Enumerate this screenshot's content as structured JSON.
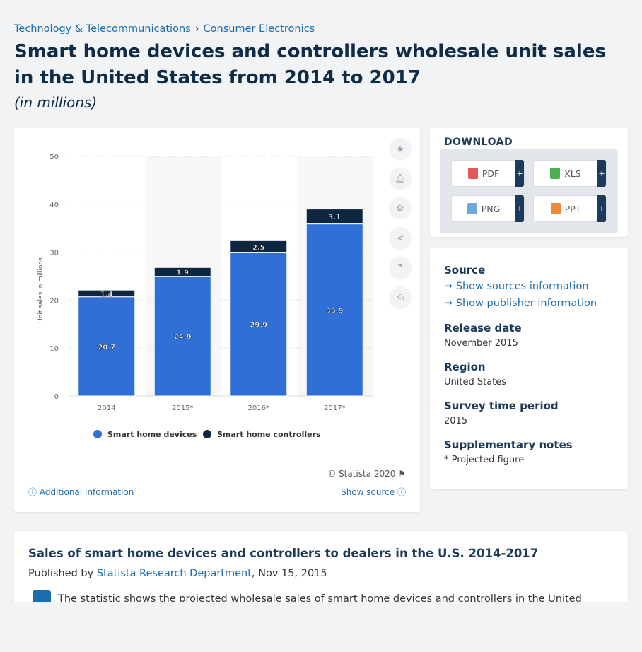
{
  "breadcrumb": {
    "first": "Technology & Telecommunications",
    "second": "Consumer Electronics"
  },
  "title": "Smart home devices and controllers wholesale unit sales in the United States from 2014 to 2017",
  "subtitle": "(in millions)",
  "tools": [
    "star-icon",
    "bell-icon",
    "gear-icon",
    "share-icon",
    "quote-icon",
    "print-icon"
  ],
  "download": {
    "title": "DOWNLOAD",
    "buttons": [
      {
        "label": "PDF",
        "plus": "+",
        "color": "#e05a5a"
      },
      {
        "label": "XLS",
        "plus": "+",
        "color": "#4caf50"
      },
      {
        "label": "PNG",
        "plus": "+",
        "color": "#6fa8dc"
      },
      {
        "label": "PPT",
        "plus": "+",
        "color": "#ef8a3c"
      }
    ]
  },
  "info": {
    "source_label": "Source",
    "show_sources": "Show sources information",
    "show_publisher": "Show publisher information",
    "release_label": "Release date",
    "release_value": "November 2015",
    "region_label": "Region",
    "region_value": "United States",
    "survey_label": "Survey time period",
    "survey_value": "2015",
    "notes_label": "Supplementary notes",
    "notes_value": "* Projected figure"
  },
  "chart_footer": {
    "copyright": "© Statista 2020",
    "additional": "Additional Information",
    "show_source": "Show source"
  },
  "description": {
    "title": "Sales of smart home devices and controllers to dealers in the U.S. 2014-2017",
    "published_by": "Published by",
    "publisher": "Statista Research Department",
    "date": ", Nov 15, 2015",
    "text": "The statistic shows the projected wholesale sales of smart home devices and controllers in the United"
  },
  "chart_data": {
    "type": "bar",
    "stacked": true,
    "categories": [
      "2014",
      "2015*",
      "2016*",
      "2017*"
    ],
    "series": [
      {
        "name": "Smart home devices",
        "values": [
          20.7,
          24.9,
          29.9,
          35.9
        ],
        "color": "#2f6fd6"
      },
      {
        "name": "Smart home controllers",
        "values": [
          1.4,
          1.9,
          2.5,
          3.1
        ],
        "color": "#0f2640"
      }
    ],
    "ylabel": "Unit sales in millions",
    "ylim": [
      0,
      50
    ],
    "yticks": [
      0,
      10,
      20,
      30,
      40,
      50
    ],
    "grid": true,
    "legend": "bottom"
  }
}
